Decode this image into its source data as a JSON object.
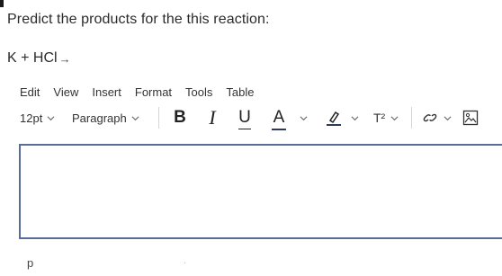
{
  "question": {
    "prompt": "Predict the products for the this reaction:",
    "equation": "K + HCl",
    "arrow": "→"
  },
  "menubar": [
    "Edit",
    "View",
    "Insert",
    "Format",
    "Tools",
    "Table"
  ],
  "toolbar": {
    "font_size": "12pt",
    "block_format": "Paragraph",
    "bold": "B",
    "italic": "I",
    "underline": "U",
    "text_color": "A",
    "superscript": "T²"
  },
  "editor": {
    "content": ""
  },
  "statusbar": {
    "path": "p"
  },
  "colors": {
    "editor_border": "#5a6d98",
    "text_color_underline": "#2e3a5c"
  }
}
